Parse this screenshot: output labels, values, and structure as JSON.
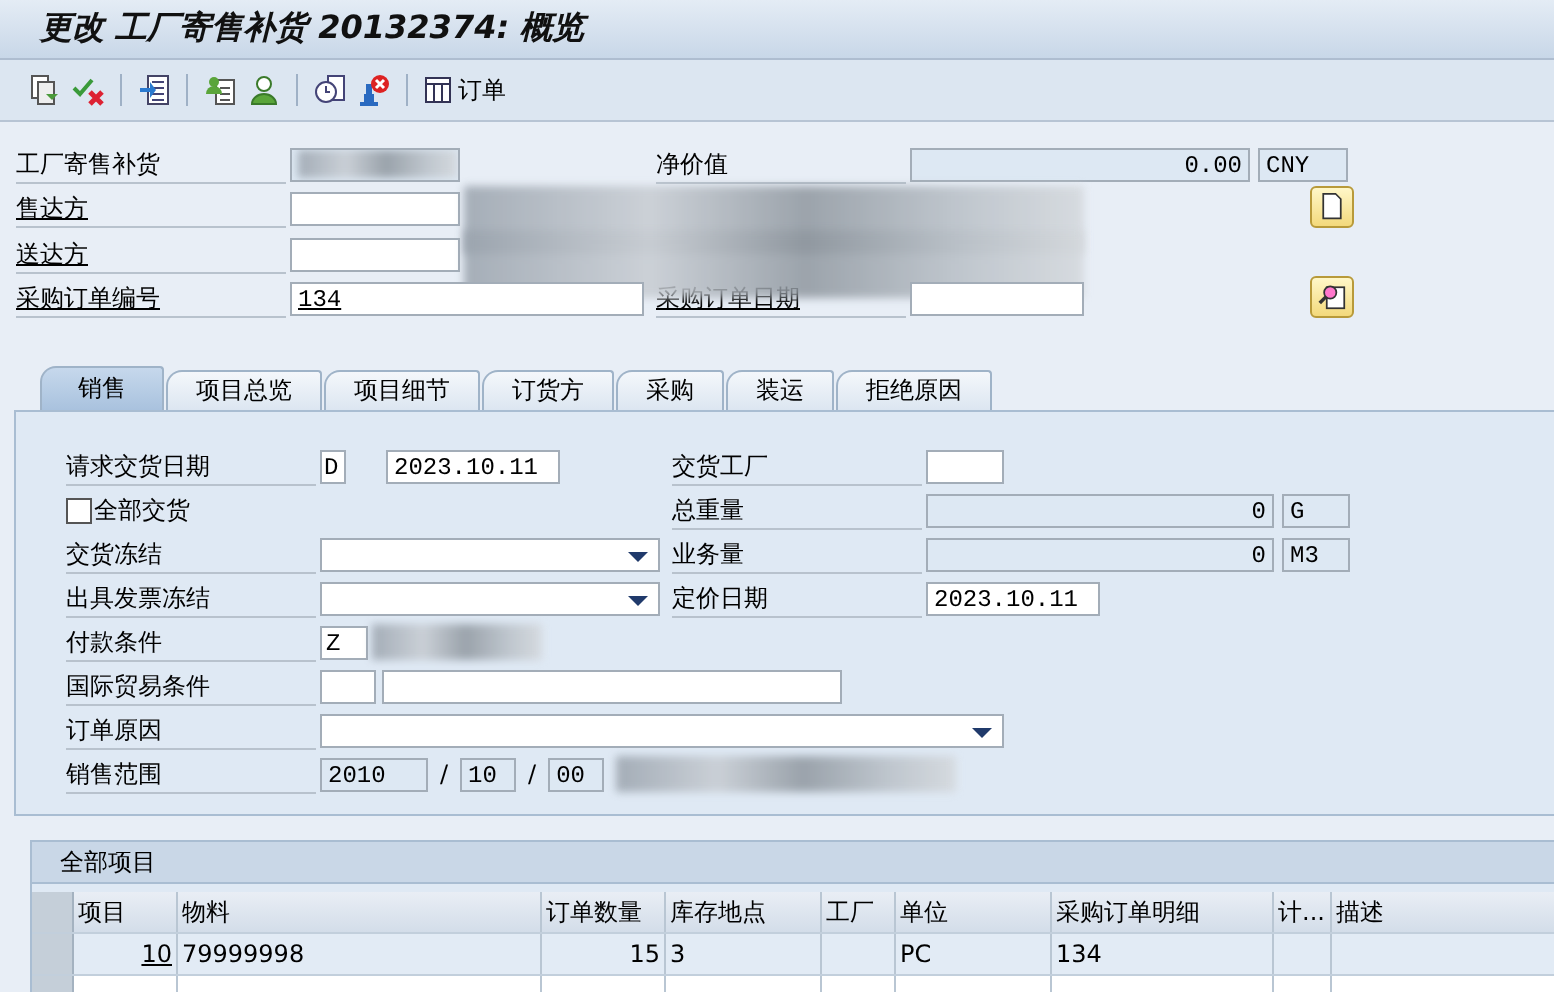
{
  "window": {
    "title": "更改 工厂寄售补货 20132374: 概览"
  },
  "toolbar": {
    "order_button": "订单"
  },
  "header": {
    "doc_type_label": "工厂寄售补货",
    "net_value_label": "净价值",
    "net_value": "0.00",
    "currency": "CNY",
    "sold_to_label": "售达方",
    "ship_to_label": "送达方",
    "po_number_label": "采购订单编号",
    "po_number": "134",
    "po_date_label": "采购订单日期"
  },
  "tabs": [
    {
      "label": "销售",
      "selected": true
    },
    {
      "label": "项目总览",
      "selected": false
    },
    {
      "label": "项目细节",
      "selected": false
    },
    {
      "label": "订货方",
      "selected": false
    },
    {
      "label": "采购",
      "selected": false
    },
    {
      "label": "装运",
      "selected": false
    },
    {
      "label": "拒绝原因",
      "selected": false
    }
  ],
  "sales": {
    "req_date_label": "请求交货日期",
    "req_date_format": "D",
    "req_date": "2023.10.11",
    "plant_label": "交货工厂",
    "complete_delivery": {
      "label": "全部交货",
      "checked": false
    },
    "weight_label": "总重量",
    "weight": "0",
    "weight_unit": "G",
    "delivery_block_label": "交货冻结",
    "volume_label": "业务量",
    "volume": "0",
    "volume_unit": "M3",
    "billing_block_label": "出具发票冻结",
    "pricing_date_label": "定价日期",
    "pricing_date": "2023.10.11",
    "payment_terms_label": "付款条件",
    "payment_terms": "Z",
    "incoterms_label": "国际贸易条件",
    "order_reason_label": "订单原因",
    "sales_area_label": "销售范围",
    "sales_area": [
      "2010",
      "10",
      "00"
    ],
    "sales_area_separators": [
      "/",
      "/"
    ]
  },
  "items_table": {
    "title": "全部项目",
    "columns": [
      "项目",
      "物料",
      "订单数量",
      "库存地点",
      "工厂",
      "单位",
      "采购订单明细",
      "计...",
      "描述"
    ],
    "rows": [
      {
        "cells": [
          "10",
          "79999998",
          "15",
          "3",
          null,
          "PC",
          "134",
          null,
          null
        ]
      }
    ]
  }
}
